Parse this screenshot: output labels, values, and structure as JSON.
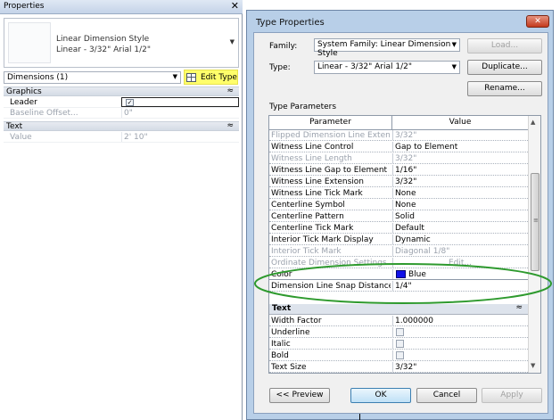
{
  "properties_palette": {
    "title": "Properties",
    "close_glyph": "✕",
    "type_selector": {
      "family": "Linear Dimension Style",
      "type": "Linear - 3/32\" Arial 1/2\""
    },
    "instance_filter": "Dimensions (1)",
    "edit_type_label": "Edit Type",
    "highlight_color": "#fffe6a",
    "groups": [
      {
        "label": "Graphics",
        "rows": [
          {
            "label": "Leader",
            "value": "",
            "checked": true
          },
          {
            "label": "Baseline Offset...",
            "value": "0\""
          }
        ]
      },
      {
        "label": "Text",
        "rows": [
          {
            "label": "Value",
            "value": "2'  10\""
          }
        ]
      }
    ]
  },
  "type_properties_dialog": {
    "title": "Type Properties",
    "family_label": "Family:",
    "family_value": "System Family: Linear Dimension Style",
    "type_label": "Type:",
    "type_value": "Linear - 3/32\" Arial 1/2\"",
    "buttons": {
      "load": "Load...",
      "duplicate": "Duplicate...",
      "rename": "Rename...",
      "preview": "<< Preview",
      "ok": "OK",
      "cancel": "Cancel",
      "apply": "Apply"
    },
    "type_parameters_label": "Type Parameters",
    "grid_headers": {
      "parameter": "Parameter",
      "value": "Value"
    },
    "rows": [
      {
        "param": "Flipped Dimension Line Extension",
        "value": "3/32\"",
        "dim": true
      },
      {
        "param": "Witness Line Control",
        "value": "Gap to Element",
        "dim": false
      },
      {
        "param": "Witness Line Length",
        "value": "3/32\"",
        "dim": true
      },
      {
        "param": "Witness Line Gap to Element",
        "value": "1/16\"",
        "dim": false
      },
      {
        "param": "Witness Line Extension",
        "value": "3/32\"",
        "dim": false
      },
      {
        "param": "Witness Line Tick Mark",
        "value": "None",
        "dim": false
      },
      {
        "param": "Centerline Symbol",
        "value": "None",
        "dim": false
      },
      {
        "param": "Centerline Pattern",
        "value": "Solid",
        "dim": false
      },
      {
        "param": "Centerline Tick Mark",
        "value": "Default",
        "dim": false
      },
      {
        "param": "Interior Tick Mark Display",
        "value": "Dynamic",
        "dim": false
      },
      {
        "param": "Interior Tick Mark",
        "value": "Diagonal 1/8\"",
        "dim": true
      },
      {
        "param": "Ordinate Dimension Settings",
        "value": "Edit...",
        "dim": true
      }
    ],
    "color_row": {
      "param": "Color",
      "value": "Blue",
      "swatch": "#1010e8"
    },
    "dim_line_snap": {
      "param": "Dimension Line Snap Distance",
      "value": "1/4\""
    },
    "text_group_label": "Text",
    "text_rows": [
      {
        "param": "Width Factor",
        "value": "1.000000",
        "checkbox": false
      },
      {
        "param": "Underline",
        "value": "",
        "checkbox": true
      },
      {
        "param": "Italic",
        "value": "",
        "checkbox": true
      },
      {
        "param": "Bold",
        "value": "",
        "checkbox": true
      },
      {
        "param": "Text Size",
        "value": "3/32\"",
        "checkbox": false
      }
    ],
    "annotation_color": "#2e9a2e"
  }
}
